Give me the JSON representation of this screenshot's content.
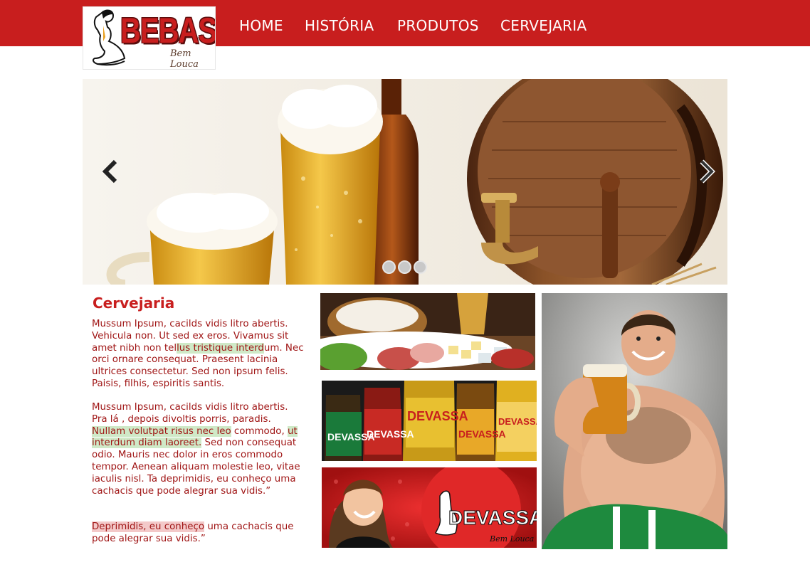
{
  "header": {
    "logo": {
      "brand": "BEBASSA",
      "tagline": "Bem Louca"
    },
    "nav": [
      {
        "label": "HOME"
      },
      {
        "label": "HISTÓRIA"
      },
      {
        "label": "PRODUTOS"
      },
      {
        "label": "CERVEJARIA"
      }
    ]
  },
  "slider": {
    "prev_icon": "chevron-left-icon",
    "next_icon": "chevron-right-icon",
    "dots_count": 3,
    "active_dot": 0
  },
  "content": {
    "title": "Cervejaria",
    "paragraph1": {
      "before": "Mussum Ipsum, cacilds vidis litro abertis. Vehicula non. Ut sed ex eros. Vivamus sit amet nibh non tel",
      "highlight": "lus tristique interd",
      "after": "um. Nec orci ornare consequat. Praesent lacinia ultrices consectetur. Sed non ipsum felis. Paisis, filhis, espiritis santis."
    },
    "paragraph2": {
      "before": "Mussum Ipsum, cacilds vidis litro abertis. Pra lá , depois divoltis porris, paradis. ",
      "highlight1": "Nullam volutpat risus nec leo",
      "middle": " commodo, ",
      "highlight2": "ut interdum diam laoreet.",
      "after": " Sed non consequat odio. Mauris nec dolor in eros commodo tempor. Aenean aliquam molestie leo, vitae iaculis nisl. Ta deprimidis, eu conheço uma cachacis que pode alegrar sua vidis.”"
    },
    "paragraph3": {
      "highlight": "Deprimidis, eu conheço",
      "after": " uma cachacis que pode alegrar sua vidis.”"
    }
  },
  "gallery": {
    "banner_brand": "DEVASSA",
    "banner_tagline": "Bem Louca",
    "bottle_labels": [
      "DEVASSA",
      "DEVASSA",
      "DEVASSA",
      "DEVASSA",
      "DEVASSA"
    ]
  },
  "colors": {
    "brand_red": "#c81e1e",
    "text_red": "#a01616",
    "highlight_green": "#cfe9c7",
    "highlight_red": "#f3c9c9"
  }
}
